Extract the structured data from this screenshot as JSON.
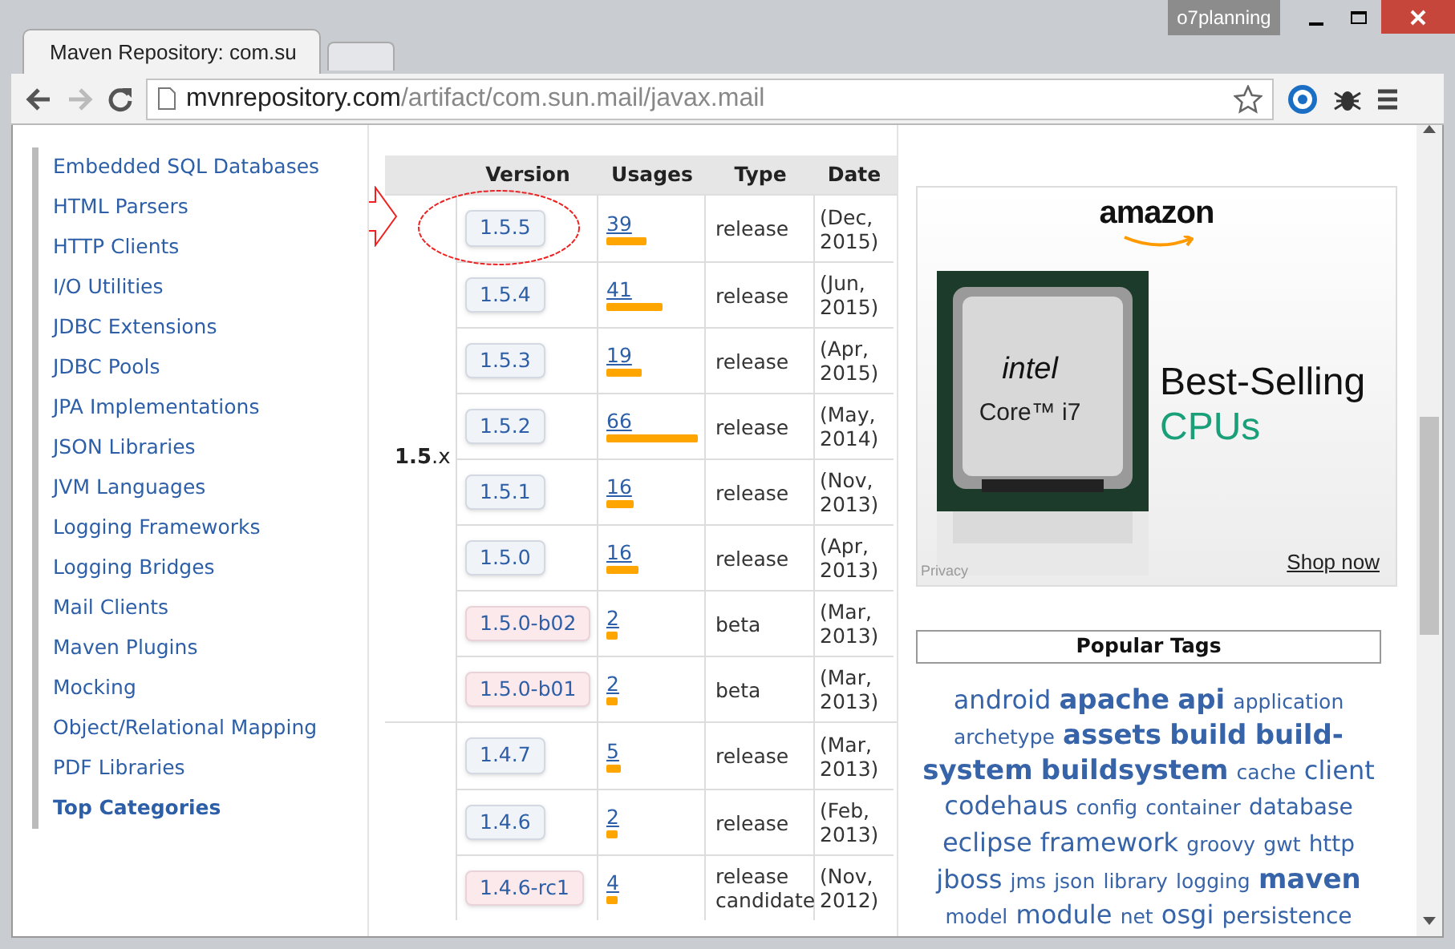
{
  "window": {
    "profile": "o7planning"
  },
  "tabs": [
    {
      "title": "Maven Repository: com.su",
      "selected": true
    }
  ],
  "address_bar": {
    "host": "mvnrepository.com",
    "path": "/artifact/com.sun.mail/javax.mail"
  },
  "sidebar": {
    "items": [
      {
        "label": "Embedded SQL Databases",
        "bold": false
      },
      {
        "label": "HTML Parsers",
        "bold": false
      },
      {
        "label": "HTTP Clients",
        "bold": false
      },
      {
        "label": "I/O Utilities",
        "bold": false
      },
      {
        "label": "JDBC Extensions",
        "bold": false
      },
      {
        "label": "JDBC Pools",
        "bold": false
      },
      {
        "label": "JPA Implementations",
        "bold": false
      },
      {
        "label": "JSON Libraries",
        "bold": false
      },
      {
        "label": "JVM Languages",
        "bold": false
      },
      {
        "label": "Logging Frameworks",
        "bold": false
      },
      {
        "label": "Logging Bridges",
        "bold": false
      },
      {
        "label": "Mail Clients",
        "bold": false
      },
      {
        "label": "Maven Plugins",
        "bold": false
      },
      {
        "label": "Mocking",
        "bold": false
      },
      {
        "label": "Object/Relational Mapping",
        "bold": false
      },
      {
        "label": "PDF Libraries",
        "bold": false
      },
      {
        "label": "Top Categories",
        "bold": true
      }
    ]
  },
  "table": {
    "columns": [
      "Version",
      "Usages",
      "Type",
      "Date"
    ],
    "groups": [
      {
        "label": "**1.5**.x",
        "rows": [
          {
            "version": "1.5.5",
            "kind": "release",
            "usages": "39",
            "level": 0.44,
            "type": "release",
            "date": "(Dec, 2015)"
          },
          {
            "version": "1.5.4",
            "kind": "release",
            "usages": "41",
            "level": 0.61,
            "type": "release",
            "date": "(Jun, 2015)"
          },
          {
            "version": "1.5.3",
            "kind": "release",
            "usages": "19",
            "level": 0.39,
            "type": "release",
            "date": "(Apr, 2015)"
          },
          {
            "version": "1.5.2",
            "kind": "release",
            "usages": "66",
            "level": 1,
            "type": "release",
            "date": "(May, 2014)"
          },
          {
            "version": "1.5.1",
            "kind": "release",
            "usages": "16",
            "level": 0.3,
            "type": "release",
            "date": "(Nov, 2013)"
          },
          {
            "version": "1.5.0",
            "kind": "release",
            "usages": "16",
            "level": 0.35,
            "type": "release",
            "date": "(Apr, 2013)"
          },
          {
            "version": "1.5.0-b02",
            "kind": "prerelease",
            "usages": "2",
            "level": 0.12,
            "type": "beta",
            "date": "(Mar, 2013)"
          },
          {
            "version": "1.5.0-b01",
            "kind": "prerelease",
            "usages": "2",
            "level": 0.12,
            "type": "beta",
            "date": "(Mar, 2013)"
          }
        ]
      },
      {
        "rows": [
          {
            "version": "1.4.7",
            "kind": "release",
            "usages": "5",
            "level": 0.16,
            "type": "release",
            "date": "(Mar, 2013)"
          },
          {
            "version": "1.4.6",
            "kind": "release",
            "usages": "2",
            "level": 0.12,
            "type": "release",
            "date": "(Feb, 2013)"
          },
          {
            "version": "1.4.6-rc1",
            "kind": "prerelease",
            "usages": "4",
            "level": 0.12,
            "type": "release candidate",
            "date": "(Nov, 2012)"
          }
        ]
      }
    ]
  },
  "ad": {
    "brand": "amazon",
    "headline": "Best-Selling",
    "subline": "CPUs",
    "chip_brand": "intel",
    "chip_model": "Core™ i7",
    "privacy": "Privacy",
    "link": "Shop now"
  },
  "popular_tags": {
    "title": "Popular Tags",
    "tags": [
      {
        "label": "android",
        "kind": "lg"
      },
      {
        "label": "apache",
        "kind": "xl"
      },
      {
        "label": "api",
        "kind": "xl"
      },
      {
        "label": "application",
        "kind": "sm"
      },
      {
        "label": "archetype",
        "kind": "sm"
      },
      {
        "label": "assets",
        "kind": "xl"
      },
      {
        "label": "build",
        "kind": "xl"
      },
      {
        "label": "build-",
        "kind": "xl"
      },
      {
        "label": "system",
        "kind": "xl"
      },
      {
        "label": "buildsystem",
        "kind": "xl"
      },
      {
        "label": "cache",
        "kind": "sm"
      },
      {
        "label": "client",
        "kind": "lg"
      },
      {
        "label": "codehaus",
        "kind": "lg"
      },
      {
        "label": "config",
        "kind": "sm"
      },
      {
        "label": "container",
        "kind": "sm"
      },
      {
        "label": "database",
        "kind": "md"
      },
      {
        "label": "eclipse",
        "kind": "lg"
      },
      {
        "label": "framework",
        "kind": "lg"
      },
      {
        "label": "groovy",
        "kind": "sm"
      },
      {
        "label": "gwt",
        "kind": "sm"
      },
      {
        "label": "http",
        "kind": "md"
      },
      {
        "label": "jboss",
        "kind": "lg"
      },
      {
        "label": "jms",
        "kind": "sm"
      },
      {
        "label": "json",
        "kind": "sm"
      },
      {
        "label": "library",
        "kind": "sm"
      },
      {
        "label": "logging",
        "kind": "sm"
      },
      {
        "label": "maven",
        "kind": "xl"
      },
      {
        "label": "model",
        "kind": "sm"
      },
      {
        "label": "module",
        "kind": "lg"
      },
      {
        "label": "net",
        "kind": "sm"
      },
      {
        "label": "osgi",
        "kind": "lg"
      },
      {
        "label": "persistence",
        "kind": "md"
      }
    ]
  }
}
